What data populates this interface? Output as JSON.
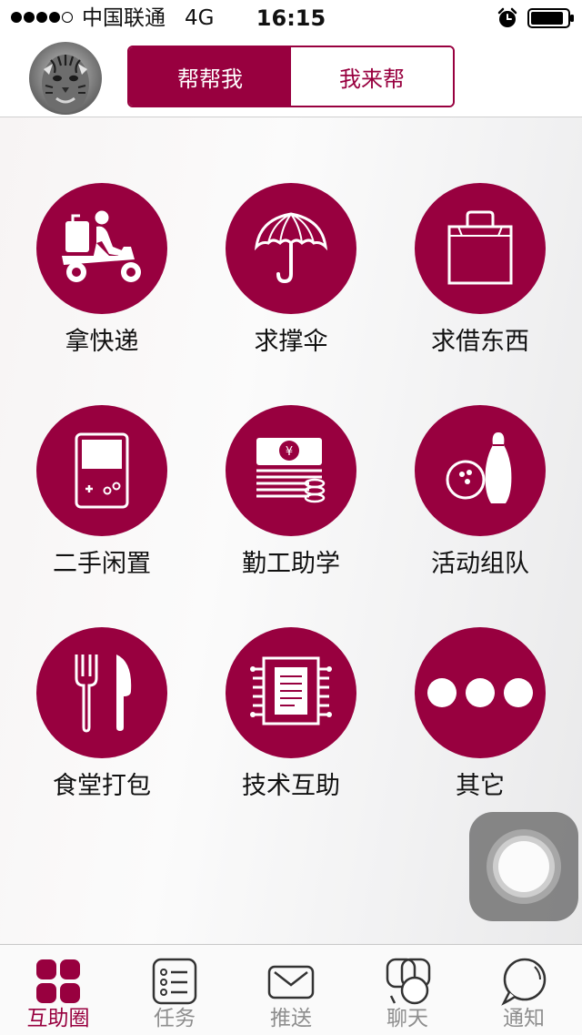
{
  "status_bar": {
    "carrier": "中国联通",
    "network": "4G",
    "time": "16:15",
    "signal_bars_filled": 4,
    "signal_bars_total": 5,
    "battery_level": 0.9,
    "icons": [
      "alarm-icon",
      "battery-icon"
    ]
  },
  "header": {
    "avatar": "user-avatar",
    "segments": [
      {
        "label": "帮帮我",
        "selected": true
      },
      {
        "label": "我来帮",
        "selected": false
      }
    ]
  },
  "theme": {
    "accent": "#98003f",
    "tab_inactive": "#8e8e8e"
  },
  "categories": [
    {
      "label": "拿快递",
      "icon": "delivery-scooter-icon"
    },
    {
      "label": "求撑伞",
      "icon": "umbrella-icon"
    },
    {
      "label": "求借东西",
      "icon": "bag-icon"
    },
    {
      "label": "二手闲置",
      "icon": "gameboy-icon"
    },
    {
      "label": "勤工助学",
      "icon": "money-stack-icon"
    },
    {
      "label": "活动组队",
      "icon": "bowling-icon"
    },
    {
      "label": "食堂打包",
      "icon": "fork-knife-icon"
    },
    {
      "label": "技术互助",
      "icon": "chip-icon"
    },
    {
      "label": "其它",
      "icon": "more-dots-icon"
    }
  ],
  "tabs": [
    {
      "label": "互助圈",
      "icon": "grid-icon",
      "active": true
    },
    {
      "label": "任务",
      "icon": "task-list-icon",
      "active": false
    },
    {
      "label": "推送",
      "icon": "envelope-icon",
      "active": false
    },
    {
      "label": "聊天",
      "icon": "chat-icon",
      "active": false
    },
    {
      "label": "通知",
      "icon": "notification-icon",
      "active": false
    }
  ]
}
